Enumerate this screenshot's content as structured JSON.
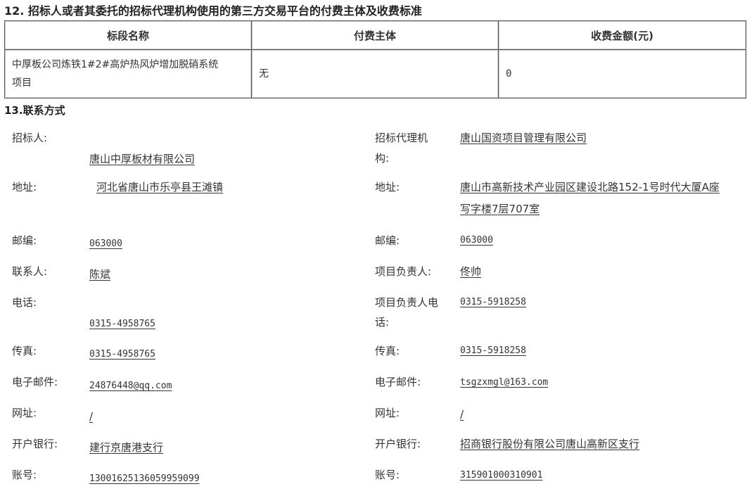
{
  "section12": {
    "title": "12. 招标人或者其委托的招标代理机构使用的第三方交易平台的付费主体及收费标准",
    "headers": [
      "标段名称",
      "付费主体",
      "收费金额(元)"
    ],
    "row": {
      "name_line1": "中厚板公司炼铁1#2#高炉热风炉增加脱硝系统",
      "name_line2": "项目",
      "payer": "无",
      "amount": "0"
    }
  },
  "section13": {
    "title": "13.联系方式",
    "left": {
      "tenderer_label": "招标人:",
      "tenderer": "唐山中厚板材有限公司",
      "address_label": "地址:",
      "address": "河北省唐山市乐亭县王滩镇",
      "zip_label": "邮编:",
      "zip": "063000",
      "contact_label": "联系人:",
      "contact": "陈斌",
      "phone_label": "电话:",
      "phone": "0315-4958765",
      "fax_label": "传真:",
      "fax": "0315-4958765",
      "email_label": "电子邮件:",
      "email": "24876448@qq.com",
      "website_label": "网址:",
      "website": "/",
      "bank_label": "开户银行:",
      "bank": "建行京唐港支行",
      "account_label": "账号:",
      "account": "13001625136059959099"
    },
    "right": {
      "agency_label_line1": "招标代理机",
      "agency_label_line2": "构:",
      "agency": "唐山国资项目管理有限公司",
      "address_label": "地址:",
      "address_line1": "唐山市高新技术产业园区建设北路152-1号时代大厦A座",
      "address_line2": "写字楼7层707室",
      "zip_label": "邮编:",
      "zip": "063000",
      "manager_label": "项目负责人:",
      "manager": "佟帅",
      "manager_phone_label_line1": "项目负责人电",
      "manager_phone_label_line2": "话:",
      "manager_phone": "0315-5918258",
      "fax_label": "传真:",
      "fax": "0315-5918258",
      "email_label": "电子邮件:",
      "email": "tsgzxmgl@163.com",
      "website_label": "网址:",
      "website": "/",
      "bank_label": "开户银行:",
      "bank": "招商银行股份有限公司唐山高新区支行",
      "account_label": "账号:",
      "account": "315901000310901"
    }
  }
}
